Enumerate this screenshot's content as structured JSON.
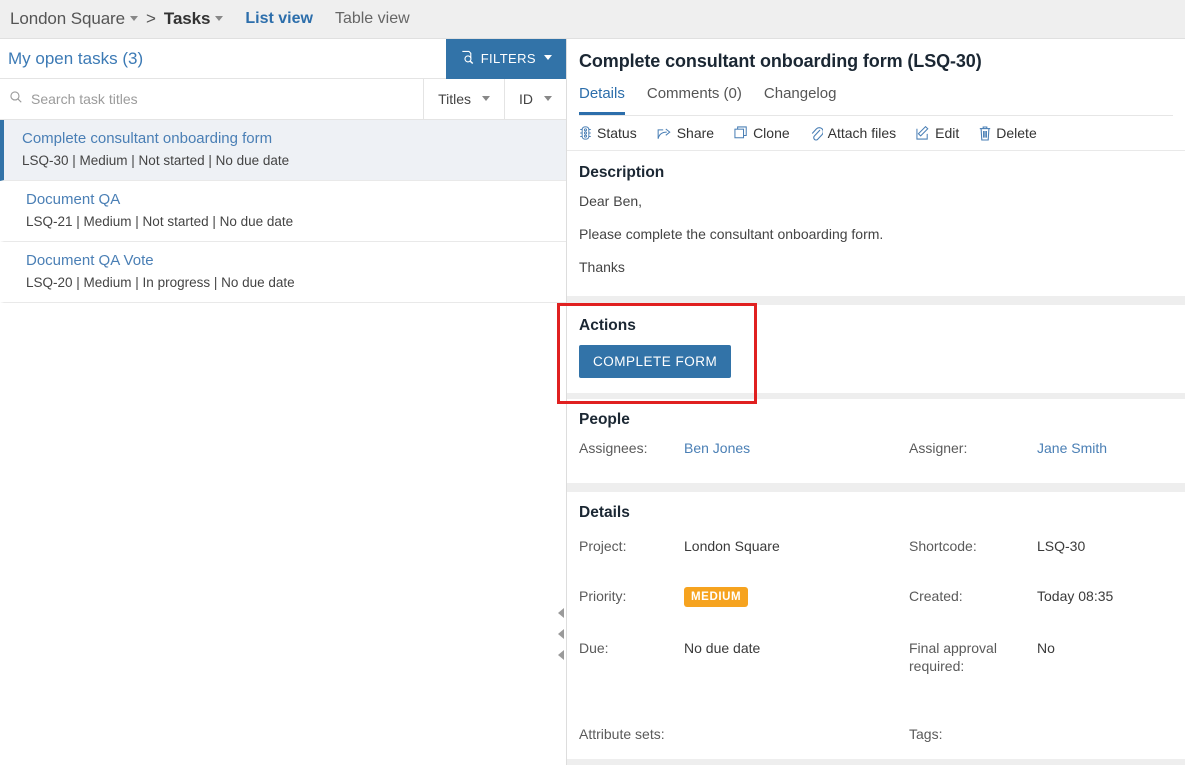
{
  "topbar": {
    "breadcrumb": [
      {
        "label": "London Square",
        "has_caret": true,
        "strong": false
      },
      {
        "label": "Tasks",
        "has_caret": true,
        "strong": true
      }
    ],
    "separator": ">",
    "views": [
      {
        "label": "List view",
        "active": true
      },
      {
        "label": "Table view",
        "active": false
      }
    ]
  },
  "left_panel": {
    "title": "My open tasks (3)",
    "filters_label": "FILTERS",
    "search": {
      "placeholder": "Search task titles",
      "value": ""
    },
    "sort_selects": [
      {
        "label": "Titles"
      },
      {
        "label": "ID"
      }
    ],
    "tasks": [
      {
        "title": "Complete consultant onboarding form",
        "meta": "LSQ-30 | Medium | Not started | No due date",
        "selected": true
      },
      {
        "title": "Document QA",
        "meta": "LSQ-21 | Medium | Not started | No due date",
        "selected": false
      },
      {
        "title": "Document QA Vote",
        "meta": "LSQ-20 | Medium | In progress | No due date",
        "selected": false
      }
    ]
  },
  "detail": {
    "title": "Complete consultant onboarding form (LSQ-30)",
    "tabs": [
      {
        "label": "Details",
        "active": true
      },
      {
        "label": "Comments (0)",
        "active": false
      },
      {
        "label": "Changelog",
        "active": false
      }
    ],
    "actions_toolbar": [
      {
        "label": "Status",
        "icon": "status-icon"
      },
      {
        "label": "Share",
        "icon": "share-icon"
      },
      {
        "label": "Clone",
        "icon": "clone-icon"
      },
      {
        "label": "Attach files",
        "icon": "paperclip-icon"
      },
      {
        "label": "Edit",
        "icon": "pencil-icon"
      },
      {
        "label": "Delete",
        "icon": "trash-icon"
      }
    ],
    "description": {
      "heading": "Description",
      "lines": [
        "Dear Ben,",
        "Please complete the consultant onboarding form.",
        "Thanks"
      ]
    },
    "actions": {
      "heading": "Actions",
      "primary_button": "COMPLETE FORM"
    },
    "people": {
      "heading": "People",
      "assignees_label": "Assignees:",
      "assignees_value": "Ben Jones",
      "assigner_label": "Assigner:",
      "assigner_value": "Jane Smith"
    },
    "details": {
      "heading": "Details",
      "project_label": "Project:",
      "project_value": "London Square",
      "shortcode_label": "Shortcode:",
      "shortcode_value": "LSQ-30",
      "priority_label": "Priority:",
      "priority_value": "MEDIUM",
      "created_label": "Created:",
      "created_value": "Today 08:35",
      "due_label": "Due:",
      "due_value": "No due date",
      "final_approval_label": "Final approval required:",
      "final_approval_value": "No",
      "attribute_sets_label": "Attribute sets:",
      "attribute_sets_value": "",
      "tags_label": "Tags:",
      "tags_value": ""
    }
  },
  "colors": {
    "accent_blue": "#3273a8",
    "link_blue": "#4a7fb5",
    "priority_orange": "#f6a31f",
    "annotation_red": "#e02020",
    "panel_bg": "#eeeeee",
    "topbar_bg": "#efefef"
  }
}
